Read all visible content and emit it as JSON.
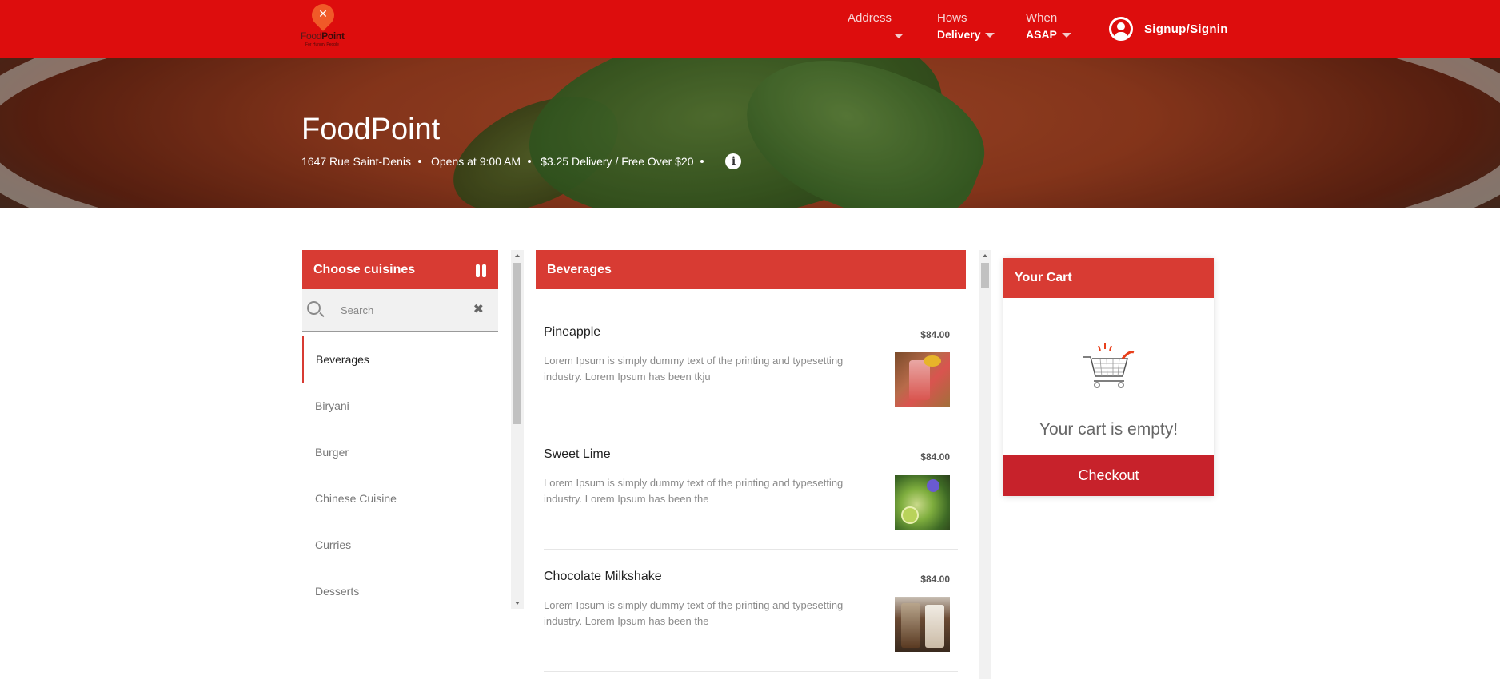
{
  "header": {
    "logo": {
      "name_a": "Food",
      "name_b": "Point",
      "tagline": "For Hungry People"
    },
    "address": {
      "label": "Address",
      "value": ""
    },
    "how": {
      "label": "Hows",
      "value": "Delivery"
    },
    "when": {
      "label": "When",
      "value": "ASAP"
    },
    "signin_label": "Signup/Signin"
  },
  "restaurant": {
    "name": "FoodPoint",
    "address": "1647 Rue Saint-Denis",
    "opens": "Opens at 9:00 AM",
    "delivery": "$3.25 Delivery / Free Over $20"
  },
  "cuisines": {
    "title": "Choose cuisines",
    "search_placeholder": "Search",
    "items": [
      {
        "label": "Beverages",
        "active": true
      },
      {
        "label": "Biryani",
        "active": false
      },
      {
        "label": "Burger",
        "active": false
      },
      {
        "label": "Chinese Cuisine",
        "active": false
      },
      {
        "label": "Curries",
        "active": false
      },
      {
        "label": "Desserts",
        "active": false
      }
    ]
  },
  "menu": {
    "title": "Beverages",
    "items": [
      {
        "name": "Pineapple",
        "price": "$84.00",
        "description": "Lorem Ipsum is simply dummy text of the printing and typesetting industry. Lorem Ipsum has been tkju"
      },
      {
        "name": "Sweet Lime",
        "price": "$84.00",
        "description": "Lorem Ipsum is simply dummy text of the printing and typesetting industry. Lorem Ipsum has been the"
      },
      {
        "name": "Chocolate Milkshake",
        "price": "$84.00",
        "description": "Lorem Ipsum is simply dummy text of the printing and typesetting industry. Lorem Ipsum has been the"
      }
    ]
  },
  "cart": {
    "title": "Your Cart",
    "empty_text": "Your cart is empty!",
    "checkout_label": "Checkout"
  },
  "colors": {
    "header_bg": "#dd0d0d",
    "panel_head": "#d83b33",
    "checkout": "#c7222b"
  }
}
